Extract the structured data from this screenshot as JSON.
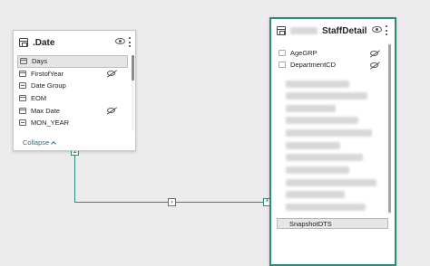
{
  "date_table": {
    "title": ".Date",
    "fields": [
      {
        "label": "Days",
        "icon": "calendar-icon",
        "selected": true,
        "hidden": false
      },
      {
        "label": "FirstofYear",
        "icon": "calendar-icon",
        "selected": false,
        "hidden": true
      },
      {
        "label": "Date Group",
        "icon": "text-icon",
        "selected": false,
        "hidden": false
      },
      {
        "label": "EOM",
        "icon": "calendar-icon",
        "selected": false,
        "hidden": false
      },
      {
        "label": "Max Date",
        "icon": "calendar-icon",
        "selected": false,
        "hidden": true
      },
      {
        "label": "MON_YEAR",
        "icon": "text-icon",
        "selected": false,
        "hidden": false
      }
    ],
    "collapse_label": "Collapse"
  },
  "staff_table": {
    "title": "StaffDetail",
    "fields": [
      {
        "label": "AgeGRP",
        "hidden": true
      },
      {
        "label": "DepartmentCD",
        "hidden": true
      }
    ],
    "snapshot_label": "SnapshotDTS"
  },
  "relationship": {
    "from_cardinality": "1",
    "to_cardinality": "*",
    "filter_direction_symbol": "›"
  },
  "colors": {
    "accent": "#2e8b7a",
    "canvas": "#ececec",
    "link": "#2b6f7e"
  }
}
